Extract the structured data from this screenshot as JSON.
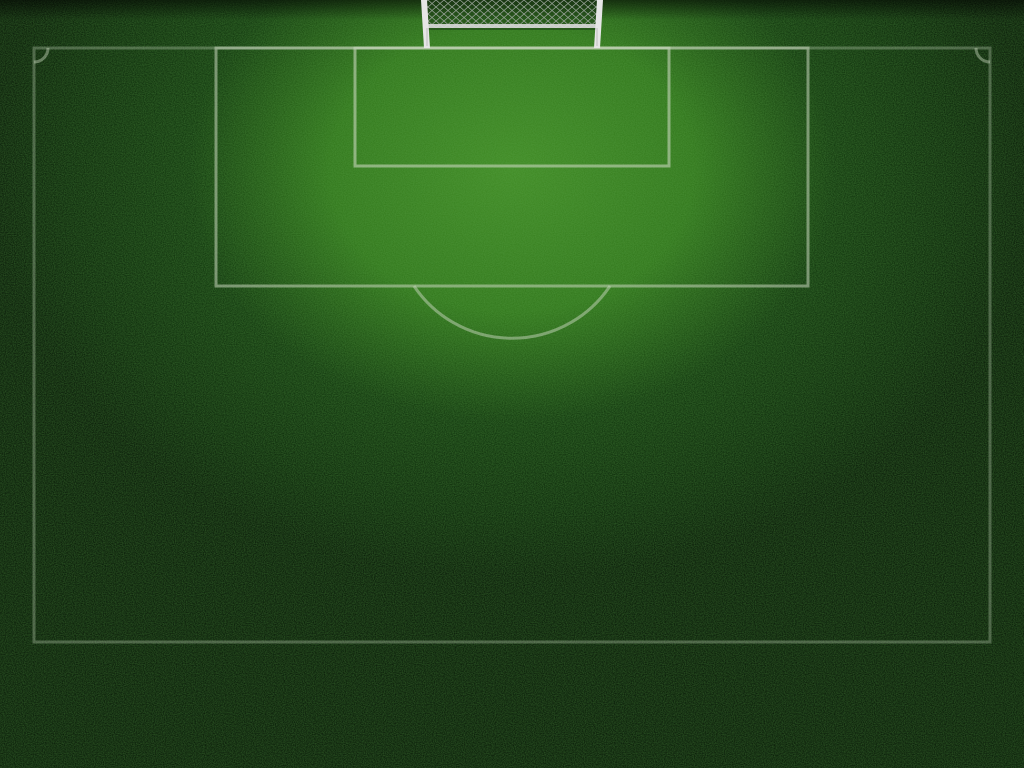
{
  "scene": {
    "type": "football-pitch-half",
    "view": "top-down",
    "lighting": "spotlight-on-goal-area"
  },
  "colors": {
    "grass_light": "#3f8a23",
    "grass_mid": "#2a6a16",
    "grass_dark": "#0d300a",
    "background": "#031103",
    "line": "#c8d6bd",
    "goal_frame": "#d9d9d9",
    "net": "#9aa39a"
  },
  "elements": {
    "goal": "goal-net",
    "touchline_box": "pitch-boundary",
    "penalty_area": "penalty-box",
    "goal_area": "six-yard-box",
    "penalty_arc": "penalty-arc",
    "corner_arcs": [
      "corner-arc-left",
      "corner-arc-right"
    ]
  }
}
